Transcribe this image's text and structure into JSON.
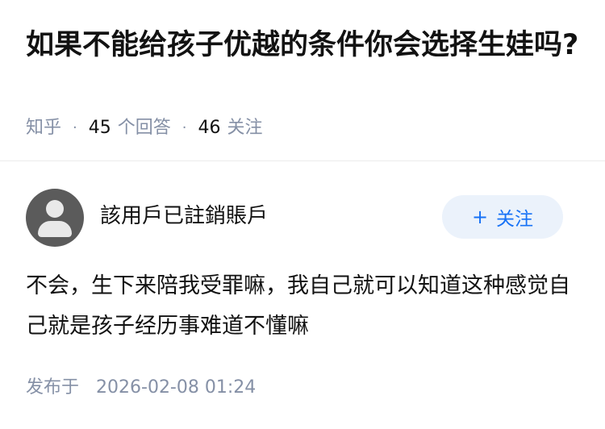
{
  "question": {
    "title": "如果不能给孩子优越的条件你会选择生娃吗?",
    "source": "知乎",
    "answers_count": "45",
    "answers_label": "个回答",
    "follows_count": "46",
    "follows_label": "关注",
    "separator": "·"
  },
  "answer": {
    "author_name": "該用戶已註銷賬戶",
    "follow_button": {
      "icon": "plus-icon",
      "plus": "+",
      "label": "关注"
    },
    "content": "不会，生下来陪我受罪嘛，我自己就可以知道这种感觉自己就是孩子经历事难道不懂嘛",
    "published_label": "发布于",
    "published_time": "2026-02-08 01:24"
  },
  "colors": {
    "accent": "#1772f6",
    "accent_bg": "#ebf2fb",
    "meta": "#8590a6",
    "text": "#121212"
  }
}
